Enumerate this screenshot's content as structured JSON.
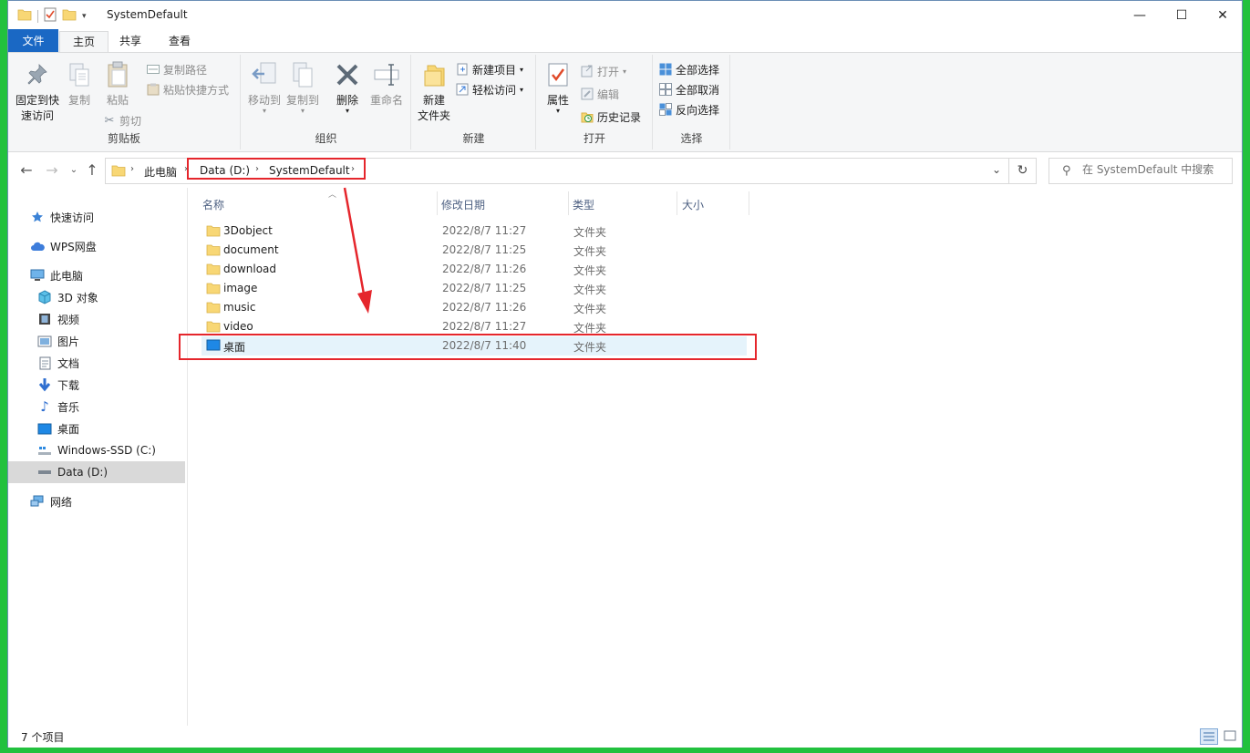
{
  "window": {
    "title": "SystemDefault"
  },
  "window_controls": {
    "minimize": "—",
    "maximize": "☐",
    "close": "✕"
  },
  "ribbon_tabs": [
    {
      "label": "文件"
    },
    {
      "label": "主页"
    },
    {
      "label": "共享"
    },
    {
      "label": "查看"
    }
  ],
  "ribbon": {
    "clipboard": {
      "pin_line1": "固定到快",
      "pin_line2": "速访问",
      "copy": "复制",
      "paste": "粘贴",
      "copy_path": "复制路径",
      "paste_shortcut": "粘贴快捷方式",
      "cut": "剪切",
      "label": "剪贴板"
    },
    "organize": {
      "move_to": "移动到",
      "copy_to": "复制到",
      "delete": "删除",
      "rename": "重命名",
      "label": "组织"
    },
    "new": {
      "new_folder_line1": "新建",
      "new_folder_line2": "文件夹",
      "new_item": "新建项目",
      "easy_access": "轻松访问",
      "label": "新建"
    },
    "open": {
      "properties": "属性",
      "open": "打开",
      "edit": "编辑",
      "history": "历史记录",
      "label": "打开"
    },
    "select": {
      "select_all": "全部选择",
      "select_none": "全部取消",
      "invert": "反向选择",
      "label": "选择"
    }
  },
  "address": {
    "crumbs": [
      "此电脑",
      "Data (D:)",
      "SystemDefault"
    ]
  },
  "search": {
    "placeholder": "在 SystemDefault 中搜索"
  },
  "nav": {
    "quick_access": "快速访问",
    "wps": "WPS网盘",
    "this_pc": "此电脑",
    "items": [
      {
        "label": "3D 对象",
        "icon": "3d-objects-icon"
      },
      {
        "label": "视频",
        "icon": "video-icon"
      },
      {
        "label": "图片",
        "icon": "pictures-icon"
      },
      {
        "label": "文档",
        "icon": "documents-icon"
      },
      {
        "label": "下载",
        "icon": "download-icon"
      },
      {
        "label": "音乐",
        "icon": "music-icon"
      },
      {
        "label": "桌面",
        "icon": "desktop-icon"
      },
      {
        "label": "Windows-SSD (C:)",
        "icon": "drive-c-icon"
      },
      {
        "label": "Data (D:)",
        "icon": "drive-d-icon"
      }
    ],
    "network": "网络"
  },
  "columns": {
    "name": "名称",
    "modified": "修改日期",
    "type": "类型",
    "size": "大小"
  },
  "files": [
    {
      "name": "3Dobject",
      "date": "2022/8/7 11:27",
      "type": "文件夹"
    },
    {
      "name": "document",
      "date": "2022/8/7 11:25",
      "type": "文件夹"
    },
    {
      "name": "download",
      "date": "2022/8/7 11:26",
      "type": "文件夹"
    },
    {
      "name": "image",
      "date": "2022/8/7 11:25",
      "type": "文件夹"
    },
    {
      "name": "music",
      "date": "2022/8/7 11:26",
      "type": "文件夹"
    },
    {
      "name": "video",
      "date": "2022/8/7 11:27",
      "type": "文件夹"
    },
    {
      "name": "桌面",
      "date": "2022/8/7 11:40",
      "type": "文件夹"
    }
  ],
  "status": {
    "item_count": "7 个项目"
  },
  "colors": {
    "accent": "#1a68c4",
    "highlight": "#e5262c",
    "folder": "#f8d775",
    "selection": "#e5f3fb"
  }
}
